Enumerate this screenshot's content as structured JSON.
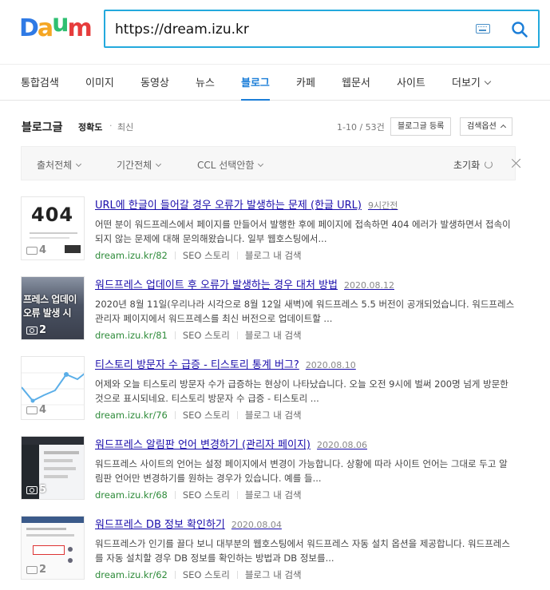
{
  "logo": {
    "letters": [
      "D",
      "a",
      "u",
      "m"
    ],
    "colors": [
      "#2f7ae5",
      "#f5a623",
      "#e63c3c",
      "#e63c3c"
    ]
  },
  "search": {
    "query": "https://dream.izu.kr",
    "accent": "#23a9dd"
  },
  "tabs": [
    {
      "label": "통합검색"
    },
    {
      "label": "이미지"
    },
    {
      "label": "동영상"
    },
    {
      "label": "뉴스"
    },
    {
      "label": "블로그"
    },
    {
      "label": "카페"
    },
    {
      "label": "웹문서"
    },
    {
      "label": "사이트"
    },
    {
      "label": "더보기"
    }
  ],
  "active_tab": "블로그",
  "section": {
    "title": "블로그글",
    "sort_accuracy": "정확도",
    "sort_dot": "·",
    "sort_recent": "최신",
    "count": "1-10 / 53건",
    "register_btn": "블로그글 등록",
    "options_btn": "검색옵션"
  },
  "filters": {
    "source": "출처전체",
    "period": "기간전체",
    "ccl": "CCL 선택안함",
    "reset": "초기화"
  },
  "results": [
    {
      "title": "URL에 한글이 들어갈 경우 오류가 발생하는 문제 (한글 URL)",
      "date": "9시간전",
      "desc": "어떤 분이 워드프레스에서 페이지를 만들어서 발행한 후에 페이지에 접속하면 404 에러가 발생하면서 접속이 되지 않는 문제에 대해 문의해왔습니다. 일부 웹호스팅에서...",
      "url": "dream.izu.kr/82",
      "seo": "SEO 스토리",
      "inblog": "블로그 내 검색",
      "img_count": "4",
      "thumb_text": "404"
    },
    {
      "title": "워드프레스 업데이트 후 오류가 발생하는 경우 대처 방법",
      "date": "2020.08.12",
      "desc": "2020년 8월 11일(우리나라 시각으로 8월 12일 새벽)에 워드프레스 5.5 버전이 공개되었습니다. 워드프레스 관리자 페이지에서 워드프레스를 최신 버전으로 업데이트할 ...",
      "url": "dream.izu.kr/81",
      "seo": "SEO 스토리",
      "inblog": "블로그 내 검색",
      "img_count": "2",
      "thumb_text": "프레스 업데이 오류 발생 시"
    },
    {
      "title": "티스토리 방문자 수 급증 - 티스토리 통계 버그?",
      "date": "2020.08.10",
      "desc": "어제와 오늘 티스토리 방문자 수가 급증하는 현상이 나타났습니다. 오늘 오전 9시에 벌써 200명 넘게 방문한 것으로 표시되네요. 티스토리 방문자 수 급증 - 티스토리 ...",
      "url": "dream.izu.kr/76",
      "seo": "SEO 스토리",
      "inblog": "블로그 내 검색",
      "img_count": "4",
      "thumb_text": ""
    },
    {
      "title": "워드프레스 알림판 언어 변경하기 (관리자 페이지)",
      "date": "2020.08.06",
      "desc": "워드프레스 사이트의 언어는 설정 페이지에서 변경이 가능합니다. 상황에 따라 사이트 언어는 그대로 두고 알림판 언어만 변경하기를 원하는 경우가 있습니다. 예를 들...",
      "url": "dream.izu.kr/68",
      "seo": "SEO 스토리",
      "inblog": "블로그 내 검색",
      "img_count": "5",
      "thumb_text": ""
    },
    {
      "title": "워드프레스 DB 정보 확인하기",
      "date": "2020.08.04",
      "desc": "워드프레스가 인기를 끌다 보니 대부분의 웹호스팅에서 워드프레스 자동 설치 옵션을 제공합니다. 워드프레스를 자동 설치할 경우 DB 정보를 확인하는 방법과 DB 정보를...",
      "url": "dream.izu.kr/62",
      "seo": "SEO 스토리",
      "inblog": "블로그 내 검색",
      "img_count": "2",
      "thumb_text": ""
    }
  ]
}
